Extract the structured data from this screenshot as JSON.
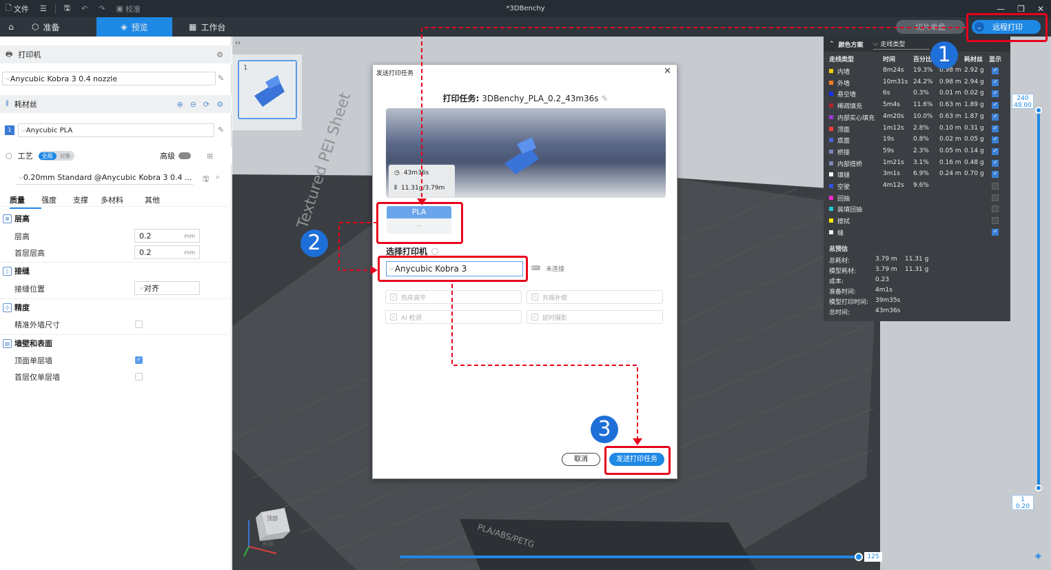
{
  "window": {
    "title": "*3DBenchy",
    "menu_file": "文件",
    "calibrate": "校准"
  },
  "toolbar": {
    "prepare": "准备",
    "preview": "预览",
    "workbench": "工作台",
    "slice_button": "切片单盘",
    "remote_print": "远程打印"
  },
  "left": {
    "printer_header": "打印机",
    "printer_value": "Anycubic Kobra 3 0.4 nozzle",
    "filament_header": "耗材丝",
    "filament_index": "1",
    "filament_value": "Anycubic PLA",
    "process_header": "工艺",
    "toggle_global": "全局",
    "toggle_object": "对象",
    "advanced": "高级",
    "process_value": "0.20mm Standard @Anycubic Kobra 3 0.4 ...",
    "tabs": [
      "质量",
      "强度",
      "支撑",
      "多材料",
      "其他"
    ],
    "groups": {
      "layer_height": "层高",
      "layer_height_label": "层高",
      "layer_height_value": "0.2",
      "first_layer_label": "首层层高",
      "first_layer_value": "0.2",
      "unit": "mm",
      "seam": "接缝",
      "seam_pos_label": "接缝位置",
      "seam_pos_value": "对齐",
      "precision": "精度",
      "precise_wall_label": "精准外墙尺寸",
      "walls": "墙壁和表面",
      "top_single_label": "顶面单层墙",
      "first_single_label": "首层仅单层墙"
    }
  },
  "thumbnail": {
    "index": "1"
  },
  "legend": {
    "scheme_label": "颜色方案",
    "scheme_value": "走线类型",
    "columns": [
      "走线类型",
      "时间",
      "百分比",
      "用量",
      "耗材丝",
      "显示"
    ],
    "rows": [
      {
        "name": "内墙",
        "color": "#f5d000",
        "time": "8m24s",
        "pct": "19.3%",
        "len": "0.98 m",
        "weight": "2.92 g",
        "shown": true
      },
      {
        "name": "外墙",
        "color": "#ff7d1e",
        "time": "10m31s",
        "pct": "24.2%",
        "len": "0.98 m",
        "weight": "2.94 g",
        "shown": true
      },
      {
        "name": "悬空墙",
        "color": "#1530ff",
        "time": "6s",
        "pct": "0.3%",
        "len": "0.01 m",
        "weight": "0.02 g",
        "shown": true
      },
      {
        "name": "稀疏填充",
        "color": "#b3242c",
        "time": "5m4s",
        "pct": "11.6%",
        "len": "0.63 m",
        "weight": "1.89 g",
        "shown": true
      },
      {
        "name": "内部实心填充",
        "color": "#9a3ad0",
        "time": "4m20s",
        "pct": "10.0%",
        "len": "0.63 m",
        "weight": "1.87 g",
        "shown": true
      },
      {
        "name": "顶面",
        "color": "#ff3a3a",
        "time": "1m12s",
        "pct": "2.8%",
        "len": "0.10 m",
        "weight": "0.31 g",
        "shown": true
      },
      {
        "name": "底面",
        "color": "#4a64e0",
        "time": "19s",
        "pct": "0.8%",
        "len": "0.02 m",
        "weight": "0.05 g",
        "shown": true
      },
      {
        "name": "桥接",
        "color": "#7a86b8",
        "time": "59s",
        "pct": "2.3%",
        "len": "0.05 m",
        "weight": "0.14 g",
        "shown": true
      },
      {
        "name": "内部搭桥",
        "color": "#7a86b8",
        "time": "1m21s",
        "pct": "3.1%",
        "len": "0.16 m",
        "weight": "0.48 g",
        "shown": true
      },
      {
        "name": "填缝",
        "color": "#ffffff",
        "time": "3m1s",
        "pct": "6.9%",
        "len": "0.24 m",
        "weight": "0.70 g",
        "shown": true
      },
      {
        "name": "空驶",
        "color": "#3050e0",
        "time": "4m12s",
        "pct": "9.6%",
        "len": "",
        "weight": "",
        "shown": false
      },
      {
        "name": "回抽",
        "color": "#ff28d0",
        "time": "",
        "pct": "",
        "len": "",
        "weight": "",
        "shown": false
      },
      {
        "name": "装填回抽",
        "color": "#20c8d8",
        "time": "",
        "pct": "",
        "len": "",
        "weight": "",
        "shown": false
      },
      {
        "name": "擦拭",
        "color": "#ffe800",
        "time": "",
        "pct": "",
        "len": "",
        "weight": "",
        "shown": false
      },
      {
        "name": "缝",
        "color": "#f0f0f0",
        "time": "",
        "pct": "",
        "len": "",
        "weight": "",
        "shown": true
      }
    ],
    "summary_title": "总预估",
    "summary": [
      {
        "label": "总耗材:",
        "v1": "3.79 m",
        "v2": "11.31 g"
      },
      {
        "label": "模型耗材:",
        "v1": "3.79 m",
        "v2": "11.31 g"
      },
      {
        "label": "成本:",
        "v1": "0.23",
        "v2": ""
      },
      {
        "label": "准备时间:",
        "v1": "4m1s",
        "v2": ""
      },
      {
        "label": "模型打印时间:",
        "v1": "39m35s",
        "v2": ""
      },
      {
        "label": "总时间:",
        "v1": "43m36s",
        "v2": ""
      }
    ]
  },
  "sliders": {
    "top_layer": "240",
    "top_height": "48.00",
    "bottom_layer": "1",
    "bottom_height": "0.20",
    "h_value": "125",
    "h_fraction": 1.0
  },
  "plate_text": {
    "sheet": "Textured PEI Sheet",
    "material": "PLA/ABS/PETG"
  },
  "cube": {
    "top": "顶部",
    "front": "前面"
  },
  "dialog": {
    "title": "发送打印任务",
    "job_label": "打印任务:",
    "job_name": "3DBenchy_PLA_0.2_43m36s",
    "time": "43m36s",
    "weight": "11.31g/3.79m",
    "filament_name": "PLA",
    "filament_sub": "--",
    "select_printer": "选择打印机",
    "printer": "Anycubic Kobra 3",
    "connection": "未连接",
    "options": [
      "热床调平",
      "共振补偿",
      "AI 检测",
      "延时摄影"
    ],
    "cancel": "取消",
    "send": "发送打印任务"
  },
  "annotations": {
    "step1": "1",
    "step2": "2",
    "step3": "3",
    "accent": "#e8001c",
    "badge_color": "#1f6fd8"
  }
}
